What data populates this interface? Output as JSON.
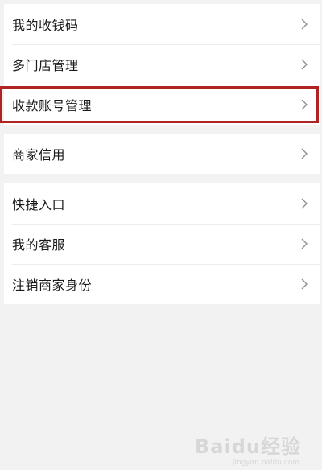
{
  "menu": {
    "group1": [
      {
        "label": "我的收钱码"
      },
      {
        "label": "多门店管理"
      },
      {
        "label": "收款账号管理"
      }
    ],
    "group2": [
      {
        "label": "商家信用"
      }
    ],
    "group3": [
      {
        "label": "快捷入口"
      },
      {
        "label": "我的客服"
      },
      {
        "label": "注销商家身份"
      }
    ]
  },
  "icons": {
    "chevron": "chevron-right-icon"
  },
  "colors": {
    "highlight_border": "#b02323",
    "background": "#f2f2f2",
    "row_background": "#ffffff"
  },
  "watermark": {
    "text": "Baidu经验",
    "sub": "jingyan.baidu.com"
  }
}
